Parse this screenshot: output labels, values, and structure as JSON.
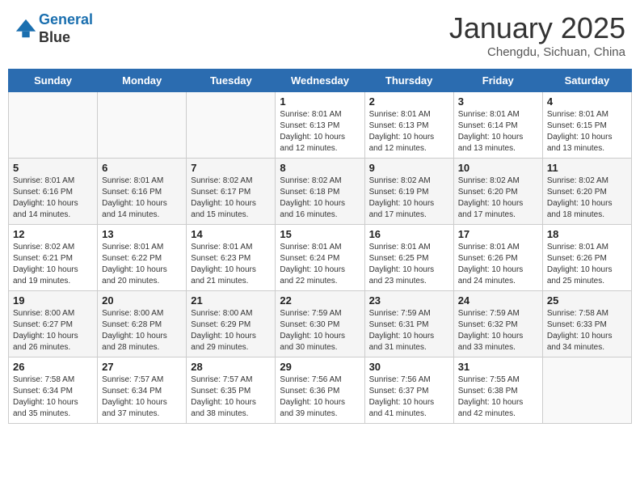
{
  "header": {
    "logo_line1": "General",
    "logo_line2": "Blue",
    "month": "January 2025",
    "location": "Chengdu, Sichuan, China"
  },
  "days_of_week": [
    "Sunday",
    "Monday",
    "Tuesday",
    "Wednesday",
    "Thursday",
    "Friday",
    "Saturday"
  ],
  "weeks": [
    [
      {
        "day": "",
        "info": ""
      },
      {
        "day": "",
        "info": ""
      },
      {
        "day": "",
        "info": ""
      },
      {
        "day": "1",
        "info": "Sunrise: 8:01 AM\nSunset: 6:13 PM\nDaylight: 10 hours\nand 12 minutes."
      },
      {
        "day": "2",
        "info": "Sunrise: 8:01 AM\nSunset: 6:13 PM\nDaylight: 10 hours\nand 12 minutes."
      },
      {
        "day": "3",
        "info": "Sunrise: 8:01 AM\nSunset: 6:14 PM\nDaylight: 10 hours\nand 13 minutes."
      },
      {
        "day": "4",
        "info": "Sunrise: 8:01 AM\nSunset: 6:15 PM\nDaylight: 10 hours\nand 13 minutes."
      }
    ],
    [
      {
        "day": "5",
        "info": "Sunrise: 8:01 AM\nSunset: 6:16 PM\nDaylight: 10 hours\nand 14 minutes."
      },
      {
        "day": "6",
        "info": "Sunrise: 8:01 AM\nSunset: 6:16 PM\nDaylight: 10 hours\nand 14 minutes."
      },
      {
        "day": "7",
        "info": "Sunrise: 8:02 AM\nSunset: 6:17 PM\nDaylight: 10 hours\nand 15 minutes."
      },
      {
        "day": "8",
        "info": "Sunrise: 8:02 AM\nSunset: 6:18 PM\nDaylight: 10 hours\nand 16 minutes."
      },
      {
        "day": "9",
        "info": "Sunrise: 8:02 AM\nSunset: 6:19 PM\nDaylight: 10 hours\nand 17 minutes."
      },
      {
        "day": "10",
        "info": "Sunrise: 8:02 AM\nSunset: 6:20 PM\nDaylight: 10 hours\nand 17 minutes."
      },
      {
        "day": "11",
        "info": "Sunrise: 8:02 AM\nSunset: 6:20 PM\nDaylight: 10 hours\nand 18 minutes."
      }
    ],
    [
      {
        "day": "12",
        "info": "Sunrise: 8:02 AM\nSunset: 6:21 PM\nDaylight: 10 hours\nand 19 minutes."
      },
      {
        "day": "13",
        "info": "Sunrise: 8:01 AM\nSunset: 6:22 PM\nDaylight: 10 hours\nand 20 minutes."
      },
      {
        "day": "14",
        "info": "Sunrise: 8:01 AM\nSunset: 6:23 PM\nDaylight: 10 hours\nand 21 minutes."
      },
      {
        "day": "15",
        "info": "Sunrise: 8:01 AM\nSunset: 6:24 PM\nDaylight: 10 hours\nand 22 minutes."
      },
      {
        "day": "16",
        "info": "Sunrise: 8:01 AM\nSunset: 6:25 PM\nDaylight: 10 hours\nand 23 minutes."
      },
      {
        "day": "17",
        "info": "Sunrise: 8:01 AM\nSunset: 6:26 PM\nDaylight: 10 hours\nand 24 minutes."
      },
      {
        "day": "18",
        "info": "Sunrise: 8:01 AM\nSunset: 6:26 PM\nDaylight: 10 hours\nand 25 minutes."
      }
    ],
    [
      {
        "day": "19",
        "info": "Sunrise: 8:00 AM\nSunset: 6:27 PM\nDaylight: 10 hours\nand 26 minutes."
      },
      {
        "day": "20",
        "info": "Sunrise: 8:00 AM\nSunset: 6:28 PM\nDaylight: 10 hours\nand 28 minutes."
      },
      {
        "day": "21",
        "info": "Sunrise: 8:00 AM\nSunset: 6:29 PM\nDaylight: 10 hours\nand 29 minutes."
      },
      {
        "day": "22",
        "info": "Sunrise: 7:59 AM\nSunset: 6:30 PM\nDaylight: 10 hours\nand 30 minutes."
      },
      {
        "day": "23",
        "info": "Sunrise: 7:59 AM\nSunset: 6:31 PM\nDaylight: 10 hours\nand 31 minutes."
      },
      {
        "day": "24",
        "info": "Sunrise: 7:59 AM\nSunset: 6:32 PM\nDaylight: 10 hours\nand 33 minutes."
      },
      {
        "day": "25",
        "info": "Sunrise: 7:58 AM\nSunset: 6:33 PM\nDaylight: 10 hours\nand 34 minutes."
      }
    ],
    [
      {
        "day": "26",
        "info": "Sunrise: 7:58 AM\nSunset: 6:34 PM\nDaylight: 10 hours\nand 35 minutes."
      },
      {
        "day": "27",
        "info": "Sunrise: 7:57 AM\nSunset: 6:34 PM\nDaylight: 10 hours\nand 37 minutes."
      },
      {
        "day": "28",
        "info": "Sunrise: 7:57 AM\nSunset: 6:35 PM\nDaylight: 10 hours\nand 38 minutes."
      },
      {
        "day": "29",
        "info": "Sunrise: 7:56 AM\nSunset: 6:36 PM\nDaylight: 10 hours\nand 39 minutes."
      },
      {
        "day": "30",
        "info": "Sunrise: 7:56 AM\nSunset: 6:37 PM\nDaylight: 10 hours\nand 41 minutes."
      },
      {
        "day": "31",
        "info": "Sunrise: 7:55 AM\nSunset: 6:38 PM\nDaylight: 10 hours\nand 42 minutes."
      },
      {
        "day": "",
        "info": ""
      }
    ]
  ]
}
